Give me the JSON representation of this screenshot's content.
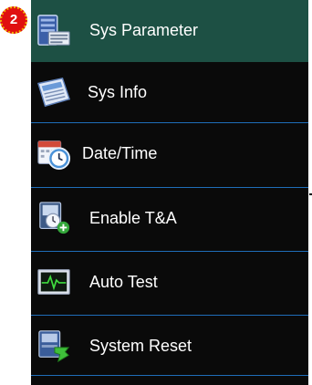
{
  "step_badge": "2",
  "menu": {
    "items": [
      {
        "label": "Sys Parameter",
        "icon": "sys-parameter-icon",
        "selected": true
      },
      {
        "label": "Sys Info",
        "icon": "sys-info-icon",
        "selected": false
      },
      {
        "label": "Date/Time",
        "icon": "calendar-clock-icon",
        "selected": false
      },
      {
        "label": "Enable T&A",
        "icon": "enable-ta-icon",
        "selected": false
      },
      {
        "label": "Auto Test",
        "icon": "monitor-pulse-icon",
        "selected": false
      },
      {
        "label": "System Reset",
        "icon": "system-reset-icon",
        "selected": false
      }
    ]
  },
  "colors": {
    "background": "#0a0a0a",
    "selected": "#1d5044",
    "divider": "#1f6db8",
    "badge": "#e01010"
  }
}
